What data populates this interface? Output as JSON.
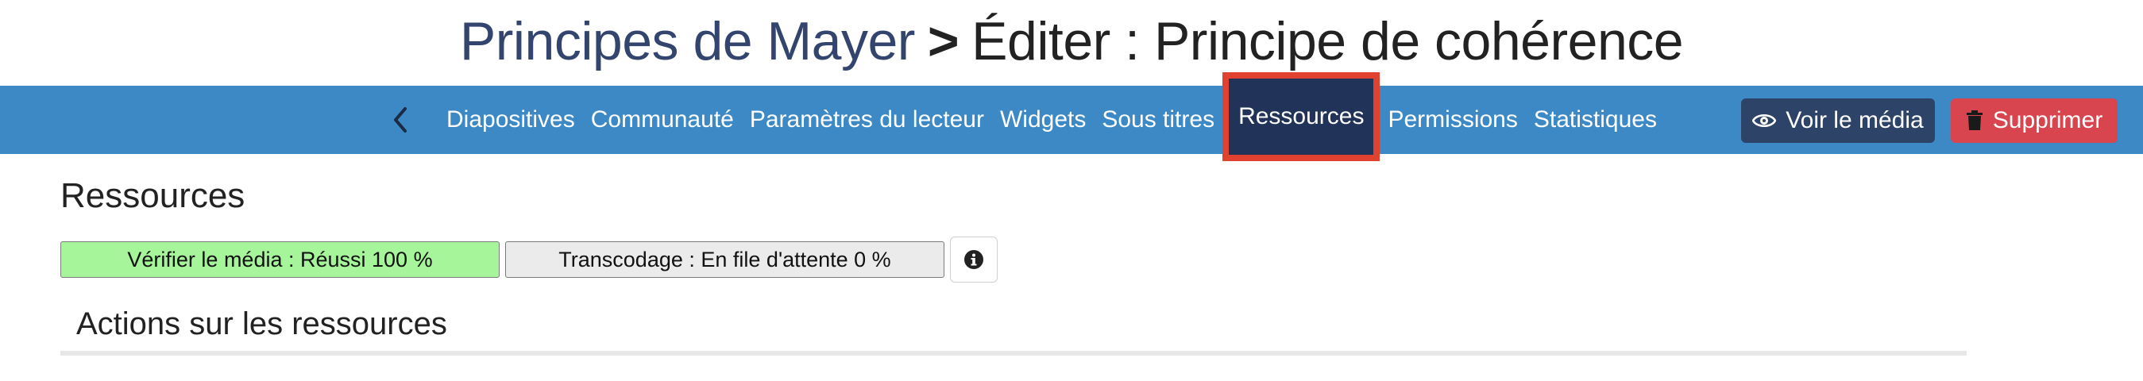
{
  "header": {
    "breadcrumb_link": "Principes de Mayer",
    "separator": ">",
    "current": "Éditer : Principe de cohérence"
  },
  "nav": {
    "back_icon": "chevron-left-icon",
    "items": [
      {
        "label": "Diapositives"
      },
      {
        "label": "Communauté"
      },
      {
        "label": "Paramètres du lecteur"
      },
      {
        "label": "Widgets"
      },
      {
        "label": "Sous titres"
      },
      {
        "label": "Ressources",
        "active": true
      },
      {
        "label": "Permissions"
      },
      {
        "label": "Statistiques"
      }
    ],
    "view_button": {
      "label": "Voir le média",
      "icon": "eye-icon"
    },
    "delete_button": {
      "label": "Supprimer",
      "icon": "trash-icon"
    }
  },
  "main": {
    "section_title": "Ressources",
    "status_verify": "Vérifier le média : Réussi 100 %",
    "status_transcode": "Transcodage : En file d'attente 0 %",
    "info_icon": "info-icon",
    "actions_title": "Actions sur les ressources"
  },
  "colors": {
    "navbar": "#3c89c6",
    "active_tab": "#22335a",
    "highlight": "#e1412f",
    "view_button": "#2d4468",
    "delete_button": "#d8454e",
    "verify_ok": "#a6f59a",
    "transcode_pending": "#ebebeb",
    "title_link": "#33456e"
  }
}
